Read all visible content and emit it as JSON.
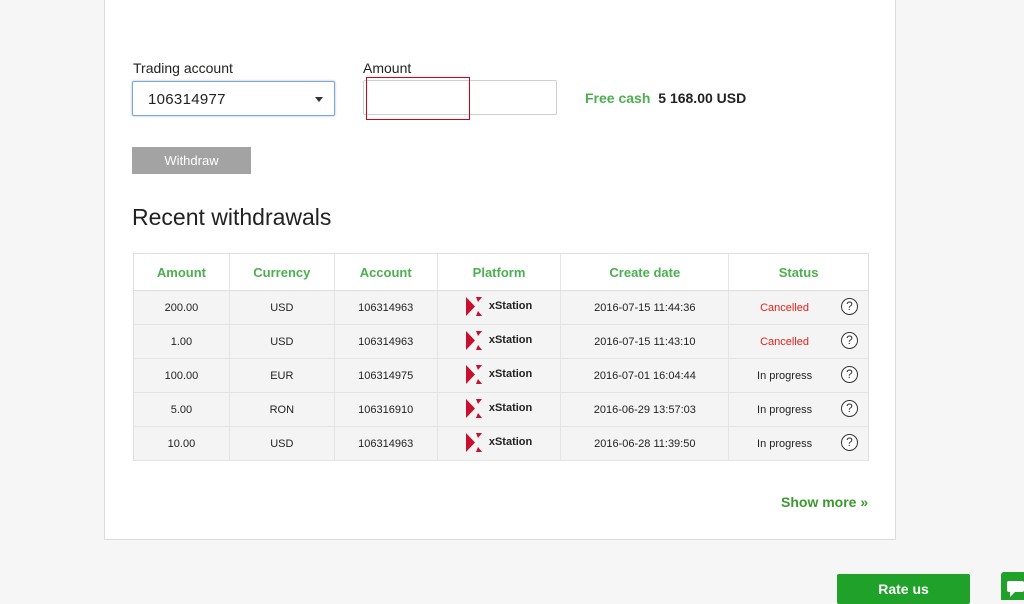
{
  "form": {
    "trading_account_label": "Trading account",
    "trading_account_value": "106314977",
    "amount_label": "Amount",
    "amount_value": "",
    "free_cash_label": "Free cash",
    "free_cash_value": "5 168.00 USD",
    "withdraw_label": "Withdraw"
  },
  "recent": {
    "title": "Recent withdrawals",
    "columns": [
      "Amount",
      "Currency",
      "Account",
      "Platform",
      "Create date",
      "Status"
    ],
    "rows": [
      {
        "amount": "200.00",
        "currency": "USD",
        "account": "106314963",
        "platform": "xStation",
        "date": "2016-07-15 11:44:36",
        "status": "Cancelled"
      },
      {
        "amount": "1.00",
        "currency": "USD",
        "account": "106314963",
        "platform": "xStation",
        "date": "2016-07-15 11:43:10",
        "status": "Cancelled"
      },
      {
        "amount": "100.00",
        "currency": "EUR",
        "account": "106314975",
        "platform": "xStation",
        "date": "2016-07-01 16:04:44",
        "status": "In progress"
      },
      {
        "amount": "5.00",
        "currency": "RON",
        "account": "106316910",
        "platform": "xStation",
        "date": "2016-06-29 13:57:03",
        "status": "In progress"
      },
      {
        "amount": "10.00",
        "currency": "USD",
        "account": "106314963",
        "platform": "xStation",
        "date": "2016-06-28 11:39:50",
        "status": "In progress"
      }
    ],
    "help_glyph": "?",
    "show_more": "Show more »"
  },
  "footer": {
    "rate_us": "Rate us"
  },
  "icons": {
    "platform": "xstation-logo-icon",
    "help": "question-circle-icon",
    "dropdown": "caret-down-icon",
    "chat": "chat-bubble-icon"
  },
  "colors": {
    "accent_green": "#4caf50",
    "link_green": "#3a9a2c",
    "button_green": "#1fa12a",
    "cancelled_red": "#e3221b",
    "error_red": "#d0021b",
    "xstation_red": "#c8102e"
  }
}
